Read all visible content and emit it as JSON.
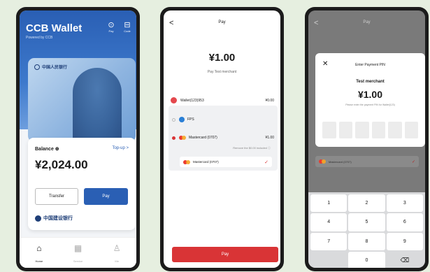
{
  "wallet": {
    "title": "CCB Wallet",
    "subtitle": "Powered by CCB",
    "scan_label": "Pay",
    "code_label": "Code",
    "note_bank": "中国人民银行",
    "balance_label": "Balance ⊕",
    "topup": "Top-up >",
    "balance_value": "¥2,024.00",
    "transfer": "Transfer",
    "pay": "Pay",
    "bank_name": "中国建设银行",
    "tabs": [
      {
        "label": "Home",
        "icon": "home-icon"
      },
      {
        "label": "Service",
        "icon": "grid-icon"
      },
      {
        "label": "Me",
        "icon": "person-icon"
      }
    ]
  },
  "pay": {
    "back": "<",
    "title": "Pay",
    "amount": "¥1.00",
    "merchant": "Pay Test merchant",
    "wallet_row": "Wallet(123)953",
    "wallet_value": "¥0.00",
    "fps": "FPS",
    "mastercard": "Mastercard (0707)",
    "mastercard_value": "¥1.00",
    "hint": "Remove the $0.00 included ⓘ",
    "selected_card": "Mastercard (0707)",
    "check": "✓",
    "pay_button": "Pay"
  },
  "pin": {
    "back": "<",
    "title": "Pay",
    "close": "✕",
    "modal_title": "Enter Payment PIN",
    "merchant": "Test merchant",
    "amount": "¥1.00",
    "hint": "Please enter the payment PIN for Wallet(123)",
    "behind_card": "Mastercard (0707)",
    "check": "✓",
    "keys": [
      "1",
      "2",
      "3",
      "4",
      "5",
      "6",
      "7",
      "8",
      "9",
      "",
      "0",
      "⌫"
    ]
  }
}
